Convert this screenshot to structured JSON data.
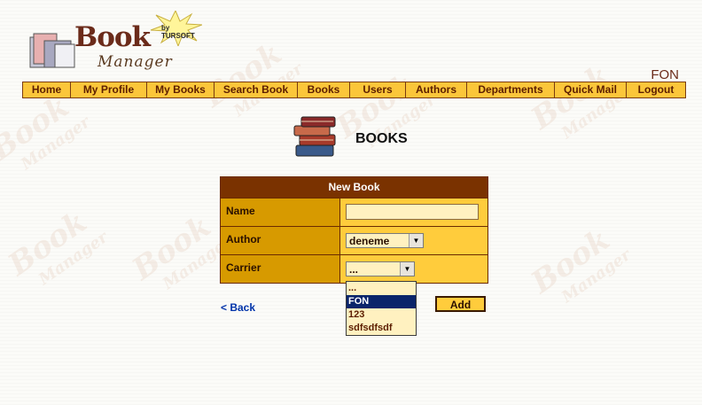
{
  "logo": {
    "word": "Book",
    "sub": "Manager",
    "by": "by TURSOFT"
  },
  "user": {
    "name": "FON"
  },
  "nav": {
    "items": [
      "Home",
      "My Profile",
      "My Books",
      "Search Book",
      "Books",
      "Users",
      "Authors",
      "Departments",
      "Quick Mail",
      "Logout"
    ]
  },
  "page": {
    "title": "BOOKS"
  },
  "form": {
    "header": "New Book",
    "name_label": "Name",
    "name_value": "",
    "author_label": "Author",
    "author_selected": "deneme",
    "carrier_label": "Carrier",
    "carrier_selected": "...",
    "carrier_options": [
      "...",
      "FON",
      "123",
      "sdfsdfsdf"
    ],
    "carrier_highlighted": "FON"
  },
  "actions": {
    "back": "< Back",
    "add": "Add"
  },
  "colors": {
    "accent": "#ffcc3c",
    "header": "#7a3200",
    "label_bg": "#d79a00",
    "text": "#5c1e00"
  }
}
